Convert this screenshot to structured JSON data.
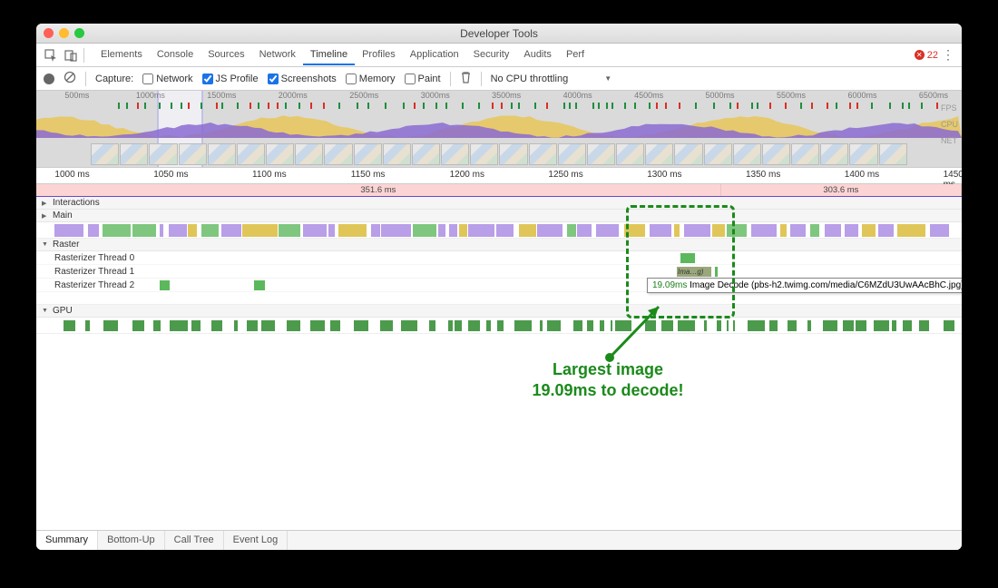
{
  "window": {
    "title": "Developer Tools"
  },
  "tabs": {
    "items": [
      "Elements",
      "Console",
      "Sources",
      "Network",
      "Timeline",
      "Profiles",
      "Application",
      "Security",
      "Audits",
      "Perf"
    ],
    "active": "Timeline",
    "error_count": "22"
  },
  "toolbar": {
    "capture_label": "Capture:",
    "network": "Network",
    "js_profile": "JS Profile",
    "screenshots": "Screenshots",
    "memory": "Memory",
    "paint": "Paint",
    "throttle": "No CPU throttling"
  },
  "overview": {
    "ticks": [
      "500ms",
      "1000ms",
      "1500ms",
      "2000ms",
      "2500ms",
      "3000ms",
      "3500ms",
      "4000ms",
      "4500ms",
      "5000ms",
      "5500ms",
      "6000ms",
      "6500ms"
    ],
    "lane_labels": [
      "FPS",
      "CPU",
      "NET"
    ],
    "selection": {
      "start_pct": 13.0,
      "end_pct": 18.0
    }
  },
  "ruler": {
    "ticks": [
      "1000 ms",
      "1050 ms",
      "1100 ms",
      "1150 ms",
      "1200 ms",
      "1250 ms",
      "1300 ms",
      "1350 ms",
      "1400 ms",
      "1450 ms"
    ]
  },
  "frames": {
    "segments": [
      {
        "label": "351.6 ms",
        "left_pct": 0,
        "width_pct": 74
      },
      {
        "label": "303.6 ms",
        "left_pct": 74,
        "width_pct": 26
      }
    ]
  },
  "tracks": {
    "interactions": "Interactions",
    "main": "Main",
    "raster": "Raster",
    "raster_threads": [
      "Rasterizer Thread 0",
      "Rasterizer Thread 1",
      "Rasterizer Thread 2"
    ],
    "gpu": "GPU"
  },
  "decode_event": {
    "label_short": "Ima…g)",
    "duration": "19.09ms",
    "desc": "Image Decode (pbs-h2.twimg.com/media/C6MZdU3UwAAcBhC.jpg)"
  },
  "annotation": {
    "line1": "Largest image",
    "line2": "19.09ms to decode!"
  },
  "bottom_tabs": {
    "items": [
      "Summary",
      "Bottom-Up",
      "Call Tree",
      "Event Log"
    ],
    "active": "Summary"
  }
}
